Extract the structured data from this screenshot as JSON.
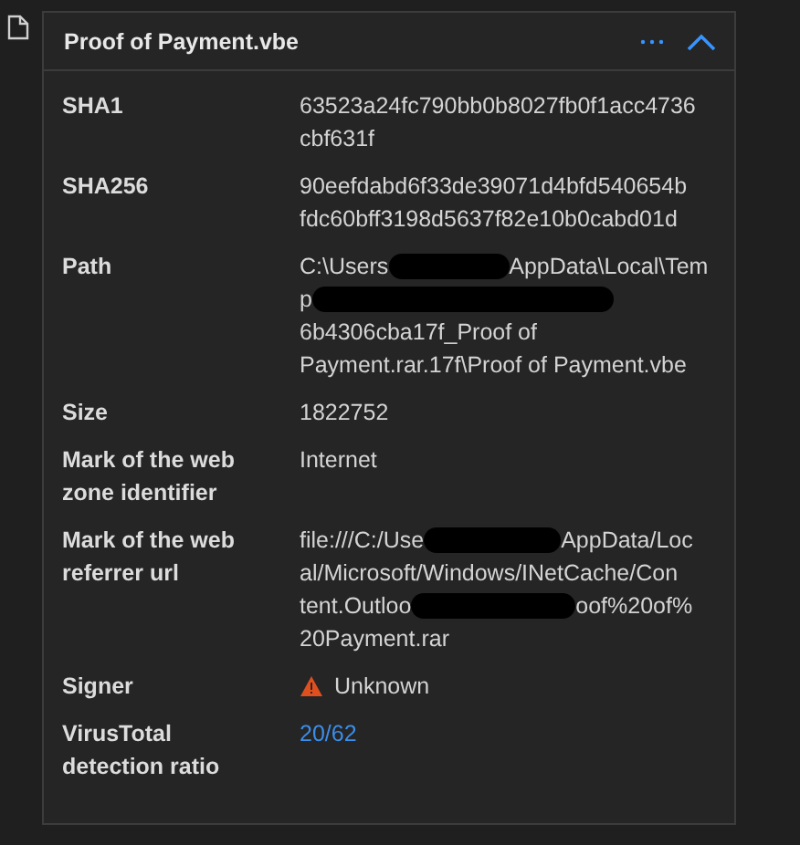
{
  "card": {
    "title": "Proof of Payment.vbe",
    "expanded": true
  },
  "rows": [
    {
      "label": "SHA1",
      "kind": "text",
      "lines": [
        [
          {
            "kind": "text",
            "text": "63523a24fc790bb0b8027fb0f1acc4736"
          }
        ],
        [
          {
            "kind": "text",
            "text": "cbf631f"
          }
        ]
      ]
    },
    {
      "label": "SHA256",
      "kind": "text",
      "lines": [
        [
          {
            "kind": "text",
            "text": "90eefdabd6f33de39071d4bfd540654b"
          }
        ],
        [
          {
            "kind": "text",
            "text": "fdc60bff3198d5637f82e10b0cabd01d"
          }
        ]
      ]
    },
    {
      "label": "Path",
      "kind": "text",
      "lines": [
        [
          {
            "kind": "text",
            "text": "C:\\Users"
          },
          {
            "kind": "redaction"
          },
          {
            "kind": "text",
            "text": "AppData\\Local\\Tem"
          }
        ],
        [
          {
            "kind": "text",
            "text": "p"
          },
          {
            "kind": "redaction"
          }
        ],
        [
          {
            "kind": "text",
            "text": "6b4306cba17f_Proof of"
          }
        ],
        [
          {
            "kind": "text",
            "text": "Payment.rar.17f\\Proof of Payment.vbe"
          }
        ]
      ]
    },
    {
      "label": "Size",
      "kind": "text",
      "lines": [
        [
          {
            "kind": "text",
            "text": "1822752"
          }
        ]
      ]
    },
    {
      "label": "Mark of the web zone identifier",
      "kind": "text",
      "lines": [
        [
          {
            "kind": "text",
            "text": "Internet"
          }
        ]
      ]
    },
    {
      "label": "Mark of the web referrer url",
      "kind": "text",
      "lines": [
        [
          {
            "kind": "text",
            "text": "file:///C:/Use"
          },
          {
            "kind": "redaction"
          },
          {
            "kind": "text",
            "text": "AppData/Loc"
          }
        ],
        [
          {
            "kind": "text",
            "text": "al/Microsoft/Windows/INetCache/Con"
          }
        ],
        [
          {
            "kind": "text",
            "text": "tent.Outloo"
          },
          {
            "kind": "redaction"
          },
          {
            "kind": "text",
            "text": "oof%20of%"
          }
        ],
        [
          {
            "kind": "text",
            "text": "20Payment.rar"
          }
        ]
      ]
    },
    {
      "label": "Signer",
      "kind": "warning",
      "lines": [
        [
          {
            "kind": "text",
            "text": "Unknown"
          }
        ]
      ]
    },
    {
      "label": "VirusTotal detection ratio",
      "kind": "link",
      "lines": [
        [
          {
            "kind": "text",
            "text": "20/62"
          }
        ]
      ]
    }
  ]
}
